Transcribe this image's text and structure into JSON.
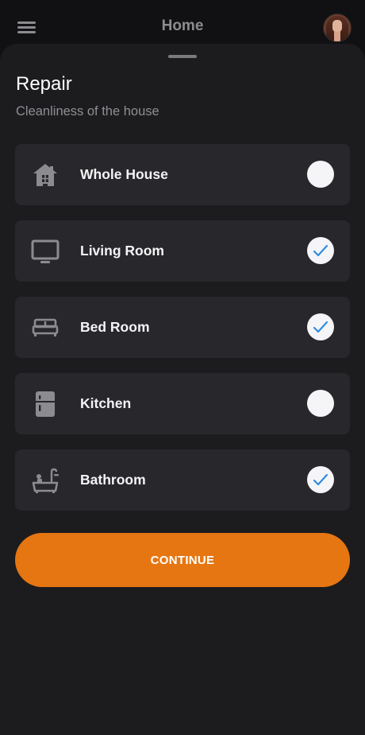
{
  "header": {
    "title": "Home",
    "menu_icon": "hamburger-menu-icon",
    "avatar_icon": "user-avatar"
  },
  "sheet": {
    "title": "Repair",
    "subtitle": "Cleanliness of the house",
    "options": [
      {
        "label": "Whole House",
        "icon": "house-icon",
        "checked": false
      },
      {
        "label": "Living Room",
        "icon": "tv-icon",
        "checked": true
      },
      {
        "label": "Bed Room",
        "icon": "bed-icon",
        "checked": true
      },
      {
        "label": "Kitchen",
        "icon": "fridge-icon",
        "checked": false
      },
      {
        "label": "Bathroom",
        "icon": "bathtub-icon",
        "checked": true
      }
    ],
    "continue_label": "CONTINUE"
  },
  "colors": {
    "accent": "#E67612",
    "check_mark": "#2F8CE0",
    "background": "#111113",
    "sheet": "#1C1C1F",
    "card": "#28282C"
  }
}
